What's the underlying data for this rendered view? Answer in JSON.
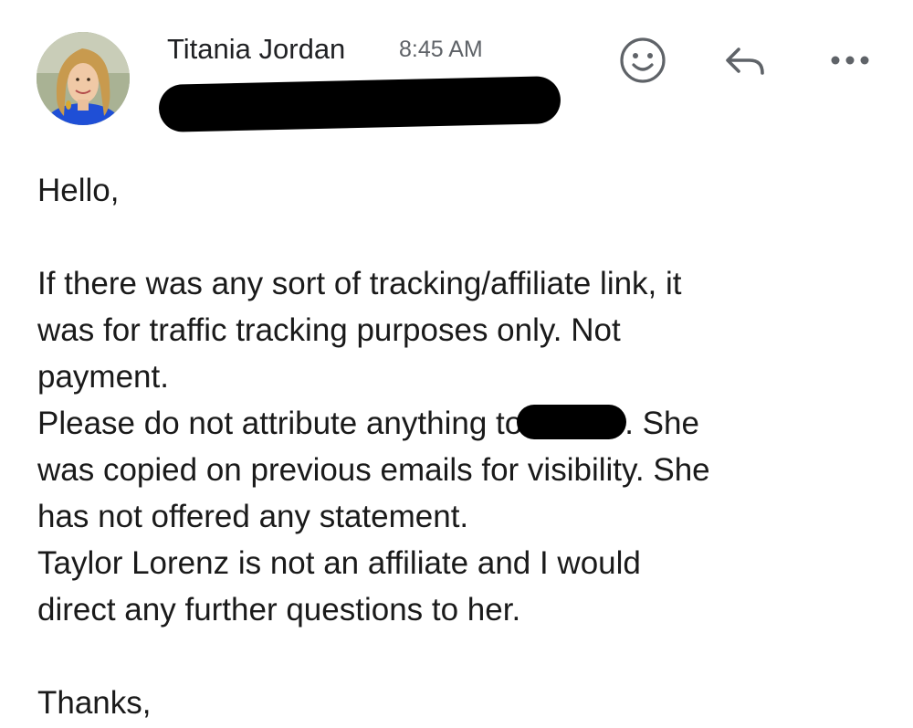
{
  "header": {
    "sender_name": "Titania Jordan",
    "time": "8:45 AM",
    "icons": {
      "emoji": "smiley-face-icon",
      "reply": "reply-arrow-icon",
      "more": "more-horizontal-icon"
    }
  },
  "body": {
    "greeting": "Hello,",
    "paragraph1_line1": "If there was any sort of tracking/affiliate link, it",
    "paragraph1_line2": "was for traffic tracking purposes only. Not",
    "paragraph1_line3": "payment.",
    "line_attribute_before": "Please do not attribute anything to",
    "line_attribute_after": ". She",
    "line_visibility": "was copied on previous emails for visibility. She",
    "line_statement": "has not offered any statement.",
    "line_taylor1": "Taylor Lorenz is not an affiliate and I would",
    "line_taylor2": "direct any further questions to her.",
    "closing": "Thanks,"
  },
  "colors": {
    "text": "#1a1a1a",
    "secondary_text": "#5f6368",
    "icon": "#5f6368",
    "redaction": "#000000"
  }
}
